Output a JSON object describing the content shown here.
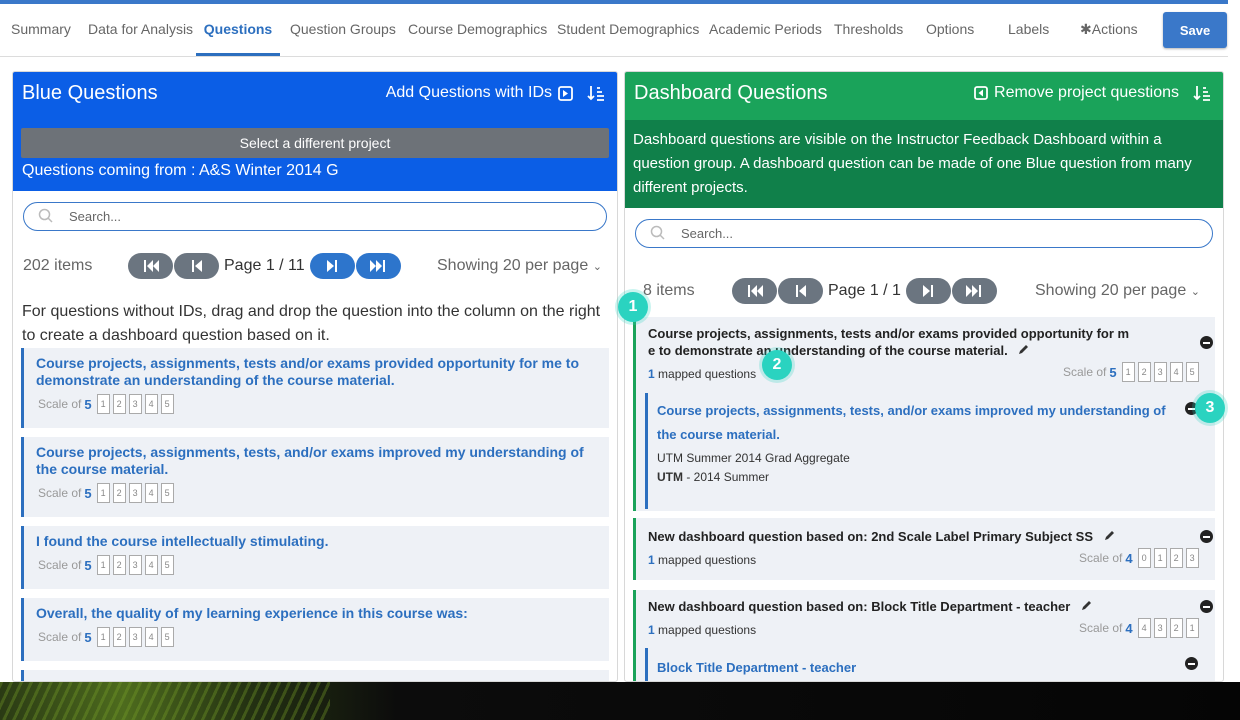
{
  "nav": {
    "tabs": [
      {
        "label": "Summary"
      },
      {
        "label": "Data for Analysis"
      },
      {
        "label": "Questions"
      },
      {
        "label": "Question Groups"
      },
      {
        "label": "Course Demographics"
      },
      {
        "label": "Student Demographics"
      },
      {
        "label": "Academic Periods"
      },
      {
        "label": "Thresholds"
      },
      {
        "label": "Options"
      },
      {
        "label": "Labels"
      },
      {
        "label": "✱Actions"
      }
    ],
    "active_tab": "Questions",
    "save_label": "Save"
  },
  "left": {
    "title": "Blue Questions",
    "action_label": "Add Questions with IDs",
    "select_project_label": "Select a different project",
    "coming_from": "Questions coming from : A&S Winter 2014 G",
    "search_placeholder": "Search...",
    "items_count": "202 items",
    "page_label": "Page 1 / 11",
    "showing": "Showing 20 per page",
    "instructions": "For questions without IDs, drag and drop the question into the column on the right to create a dashboard question based on it.",
    "questions": [
      {
        "text": "Course projects, assignments, tests and/or exams provided opportunity for me to demonstrate an understanding of the course material.",
        "scale_label": "Scale of",
        "scale_num": "5",
        "scale": [
          "1",
          "2",
          "3",
          "4",
          "5"
        ]
      },
      {
        "text": "Course projects, assignments, tests, and/or exams improved my understanding of the course material.",
        "scale_label": "Scale of",
        "scale_num": "5",
        "scale": [
          "1",
          "2",
          "3",
          "4",
          "5"
        ]
      },
      {
        "text": "I found the course intellectually stimulating.",
        "scale_label": "Scale of",
        "scale_num": "5",
        "scale": [
          "1",
          "2",
          "3",
          "4",
          "5"
        ]
      },
      {
        "text": "Overall, the quality of my learning experience in this course was:",
        "scale_label": "Scale of",
        "scale_num": "5",
        "scale": [
          "1",
          "2",
          "3",
          "4",
          "5"
        ]
      }
    ]
  },
  "right": {
    "title": "Dashboard Questions",
    "action_label": "Remove project questions",
    "info": "Dashboard questions are visible on the Instructor Feedback Dashboard within a question group. A dashboard question can be made of one Blue question from many different projects.",
    "search_placeholder": "Search...",
    "items_count": "8 items",
    "page_label": "Page 1 / 1",
    "showing": "Showing 20 per page",
    "cards": [
      {
        "title_line1": "Course projects, assignments, tests and/or exams provided opportunity for m",
        "title_line2": "e to demonstrate an understanding of the course material.",
        "mapped_num": "1",
        "mapped_text": "mapped questions",
        "scale_label": "Scale of",
        "scale_num": "5",
        "scale": [
          "1",
          "2",
          "3",
          "4",
          "5"
        ],
        "sub": {
          "q_line1": "Course projects, assignments, tests, and/or exams improved my understanding of",
          "q_line2": "the course material.",
          "project": "UTM Summer 2014 Grad Aggregate",
          "period_bold": "UTM",
          "period_rest": " - 2014 Summer"
        }
      },
      {
        "title_line1": "New dashboard question based on: 2nd Scale Label Primary Subject SS",
        "mapped_num": "1",
        "mapped_text": "mapped questions",
        "scale_label": "Scale of",
        "scale_num": "4",
        "scale": [
          "0",
          "1",
          "2",
          "3"
        ]
      },
      {
        "title_line1": "New dashboard question based on: Block Title Department - teacher",
        "mapped_num": "1",
        "mapped_text": "mapped questions",
        "scale_label": "Scale of",
        "scale_num": "4",
        "scale": [
          "4",
          "3",
          "2",
          "1"
        ],
        "sub": {
          "q_line1": "Block Title Department - teacher"
        }
      }
    ]
  },
  "badges": [
    "1",
    "2",
    "3"
  ],
  "colors": {
    "blue_header": "#0b5ee6",
    "green_header": "#1aa35a",
    "green_info": "#10804a",
    "accent": "#2c6fbf",
    "badge": "#2ad3c0"
  }
}
